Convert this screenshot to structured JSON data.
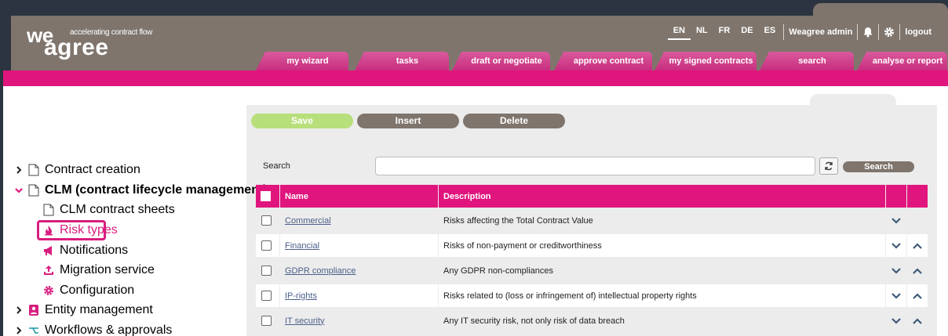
{
  "brand": {
    "logo_top": "we",
    "logo_bottom": "agree",
    "tagline": "accelerating contract flow"
  },
  "languages": [
    "EN",
    "NL",
    "FR",
    "DE",
    "ES"
  ],
  "active_language": "EN",
  "user": "Weagree admin",
  "logout": "logout",
  "tabs": [
    "my wizard",
    "tasks",
    "draft or negotiate",
    "approve contract",
    "my signed contracts",
    "search",
    "analyse or report"
  ],
  "toolbar": {
    "save": "Save",
    "insert": "Insert",
    "delete": "Delete"
  },
  "search": {
    "label": "Search",
    "value": "",
    "button": "Search"
  },
  "sidebar": [
    {
      "label": "Contract creation",
      "icon": "document-icon",
      "expand": "collapsed"
    },
    {
      "label": "CLM (contract lifecycle management)",
      "icon": "document-icon",
      "expand": "expanded"
    },
    {
      "label": "CLM contract sheets",
      "icon": "document-icon"
    },
    {
      "label": "Risk types",
      "icon": "fire-icon",
      "selected": true
    },
    {
      "label": "Notifications",
      "icon": "megaphone-icon"
    },
    {
      "label": "Migration service",
      "icon": "upload-icon"
    },
    {
      "label": "Configuration",
      "icon": "gear-icon"
    },
    {
      "label": "Entity management",
      "icon": "person-card-icon",
      "expand": "collapsed"
    },
    {
      "label": "Workflows & approvals",
      "icon": "workflow-icon",
      "expand": "collapsed"
    }
  ],
  "table": {
    "headers": {
      "name": "Name",
      "description": "Description"
    },
    "rows": [
      {
        "name": "Commercial",
        "description": "Risks affecting the Total Contract Value"
      },
      {
        "name": "Financial",
        "description": "Risks of non-payment or creditworthiness"
      },
      {
        "name": "GDPR compliance",
        "description": "Any GDPR non-compliances"
      },
      {
        "name": "IP-rights",
        "description": "Risks related to (loss or infringement of) intellectual property rights"
      },
      {
        "name": "IT security",
        "description": "Any IT security risk, not only risk of data breach"
      }
    ]
  },
  "colors": {
    "brand_pink": "#e0157d",
    "header_gray": "#7f756d",
    "save_green": "#b7df7b"
  }
}
